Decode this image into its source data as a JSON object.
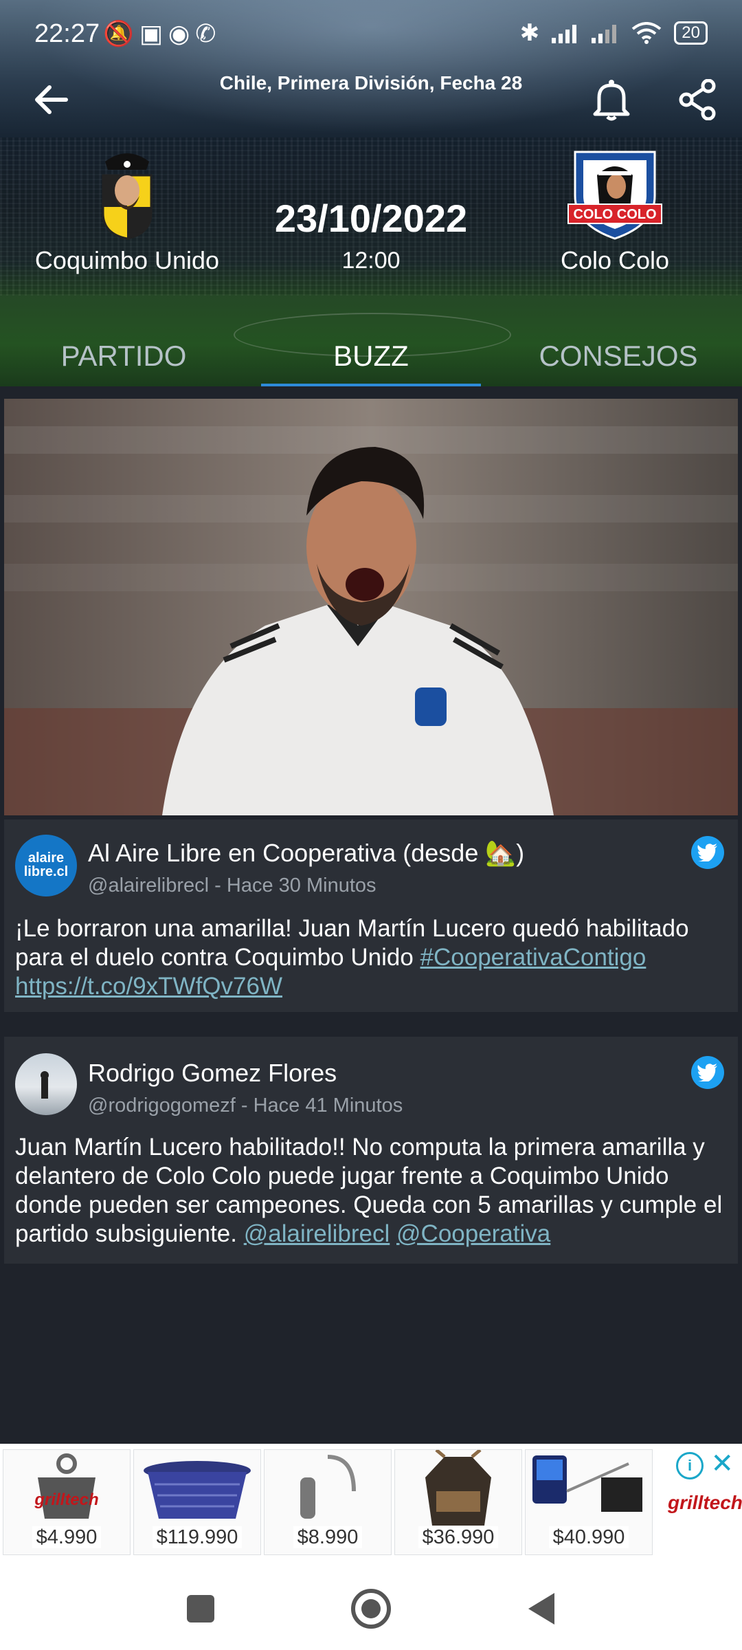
{
  "status_bar": {
    "time": "22:27",
    "left_icons": [
      "mute-icon",
      "nfc-icon",
      "record-icon",
      "phone-icon"
    ],
    "right_icons": [
      "bluetooth-icon",
      "signal-icon",
      "signal-icon",
      "wifi-icon"
    ],
    "battery": "20"
  },
  "header": {
    "league": "Chile, Primera División, Fecha 28",
    "home_team": "Coquimbo Unido",
    "away_team": "Colo Colo",
    "away_badge_text": "COLO COLO",
    "date": "23/10/2022",
    "time": "12:00"
  },
  "tabs": [
    {
      "label": "PARTIDO",
      "active": false
    },
    {
      "label": "BUZZ",
      "active": true
    },
    {
      "label": "CONSEJOS",
      "active": false
    }
  ],
  "tweets": [
    {
      "author": "Al Aire Libre en Cooperativa (desde 🏡)",
      "handle": "@alairelibrecl",
      "time": "Hace 30 Minutos",
      "avatar_text": "alaire libre.cl",
      "body": "¡Le borraron una amarilla! Juan Martín Lucero quedó habilitado para el duelo contra Coquimbo Unido ",
      "links": [
        "#CooperativaContigo",
        "https://t.co/9xTWfQv76W"
      ]
    },
    {
      "author": "Rodrigo Gomez Flores",
      "handle": "@rodrigogomezf",
      "time": "Hace 41 Minutos",
      "body": "Juan Martín Lucero habilitado!! No computa la primera amarilla y delantero de Colo Colo puede jugar frente a Coquimbo Unido donde pueden ser campeones. Queda con 5 amarillas y cumple el partido subsiguiente. ",
      "links": [
        "@alairelibrecl",
        "@Cooperativa"
      ]
    }
  ],
  "ad": {
    "prices": [
      "$4.990",
      "$119.990",
      "$8.990",
      "$36.990",
      "$40.990"
    ],
    "brand": "grilltech"
  },
  "colors": {
    "accent": "#2e8bd9",
    "link": "#7fb4c4",
    "twitter": "#1da1f2",
    "card": "#2b2f36",
    "background": "#1f232b"
  }
}
